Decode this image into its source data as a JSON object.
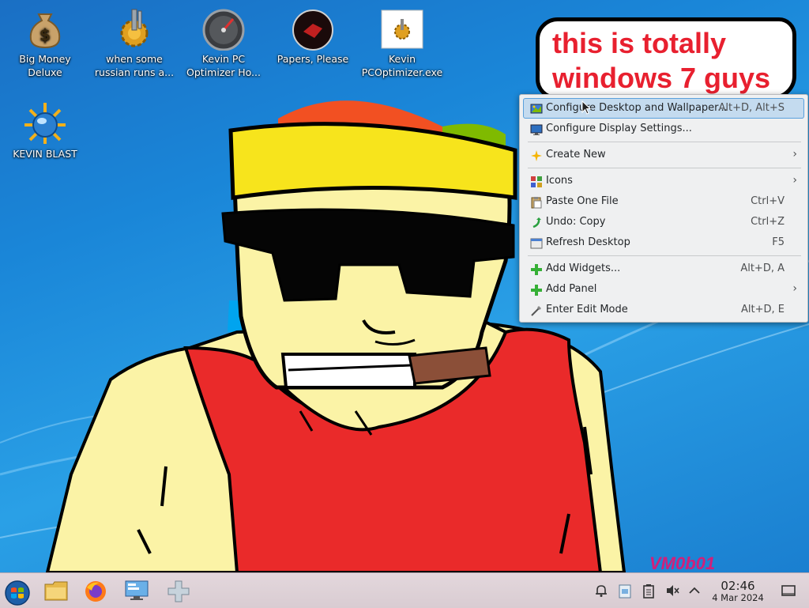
{
  "desktop": {
    "icons": [
      {
        "label": "Big Money Deluxe",
        "icon": "money-bag-icon"
      },
      {
        "label": "when some russian runs a...",
        "icon": "cogs-icon"
      },
      {
        "label": "Kevin PC Optimizer Ho...",
        "icon": "speedometer-icon"
      },
      {
        "label": "Papers, Please",
        "icon": "papers-please-icon"
      },
      {
        "label": "Kevin PCOptimizer.exe",
        "icon": "exe-file-icon"
      },
      {
        "label": "KEVIN BLAST",
        "icon": "globe-sun-icon"
      }
    ],
    "bubble_text": "this is totally windows 7 guys",
    "signature": "VM0b01",
    "colors": {
      "bubble_text": "#e8202f",
      "wallpaper_blue": "#1a86d8"
    }
  },
  "context_menu": {
    "items": [
      {
        "label": "Configure Desktop and Wallpaper...",
        "shortcut": "Alt+D, Alt+S",
        "icon": "configure-desktop-icon",
        "highlighted": true,
        "submenu": false
      },
      {
        "label": "Configure Display Settings...",
        "shortcut": "",
        "icon": "display-icon",
        "highlighted": false,
        "submenu": false
      },
      {
        "label": "Create New",
        "shortcut": "",
        "icon": "create-new-icon",
        "highlighted": false,
        "submenu": true
      },
      {
        "label": "Icons",
        "shortcut": "",
        "icon": "icons-icon",
        "highlighted": false,
        "submenu": true
      },
      {
        "label": "Paste One File",
        "shortcut": "Ctrl+V",
        "icon": "paste-icon",
        "highlighted": false,
        "submenu": false
      },
      {
        "label": "Undo: Copy",
        "shortcut": "Ctrl+Z",
        "icon": "undo-icon",
        "highlighted": false,
        "submenu": false
      },
      {
        "label": "Refresh Desktop",
        "shortcut": "F5",
        "icon": "refresh-icon",
        "highlighted": false,
        "submenu": false
      },
      {
        "label": "Add Widgets...",
        "shortcut": "Alt+D, A",
        "icon": "add-widgets-icon",
        "highlighted": false,
        "submenu": false
      },
      {
        "label": "Add Panel",
        "shortcut": "",
        "icon": "add-panel-icon",
        "highlighted": false,
        "submenu": true
      },
      {
        "label": "Enter Edit Mode",
        "shortcut": "Alt+D, E",
        "icon": "edit-mode-icon",
        "highlighted": false,
        "submenu": false
      }
    ],
    "submenu_arrow": "›"
  },
  "taskbar": {
    "pinned": [
      "start-orb-icon",
      "file-manager-icon",
      "firefox-icon",
      "network-settings-icon",
      "gamepad-icon"
    ],
    "tray": [
      "notifications-icon",
      "clipboard-icon",
      "battery-icon",
      "volume-muted-icon",
      "expand-tray-icon"
    ],
    "clock": {
      "time": "02:46",
      "date": "4 Mar 2024"
    },
    "show_desktop": "show-desktop-icon"
  }
}
